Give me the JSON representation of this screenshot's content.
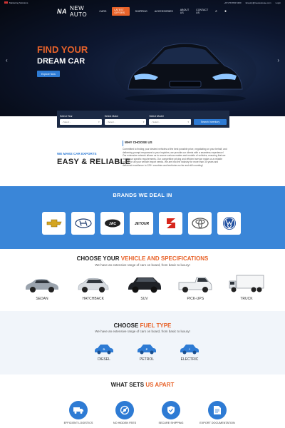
{
  "topbar": {
    "left": "Marketing Solutions",
    "phone": "+971 55 854 6360",
    "email": "Enquiry@newautouae.com",
    "login": "Login"
  },
  "brand": {
    "mark": "NA",
    "name": "NEW AUTO"
  },
  "nav": {
    "items": [
      "CARS",
      "LATEST OFFERS",
      "SHIPPING",
      "ACCESSORIES",
      "ABOUT US",
      "CONTACT US"
    ],
    "active_index": 1
  },
  "hero": {
    "line1": "FIND YOUR",
    "line2": "DREAM CAR",
    "button": "Explore Now",
    "prev": "‹",
    "next": "›"
  },
  "search": {
    "year_label": "Select Year",
    "year_value": "- Select -",
    "make_label": "Select Make",
    "make_value": "- Select -",
    "model_label": "Select Model",
    "model_value": "- Select -",
    "button": "Search Inventory"
  },
  "why": {
    "kicker": "WE MAKE CAR EXPORTS",
    "heading": "EASY & RELIABLE",
    "title": "WHY CHOOSE US",
    "text": "Committed to finding your desired vehicles at the best possible price, negotiating on your behalf, and delivering prompt responses to your inquiries, we provide our clients with a seamless experience! Our extensive network allows us to source various makes and models of vehicles, ensuring that we meet your specific requirements. Our competitive pricing and efficient service make us a reliable choice for all your vehicle import needs. We are into the industry for more than 30 years and delivered excellence to 125+ countries and territories so far and still counting!"
  },
  "brands": {
    "title": "BRANDS WE DEAL IN",
    "logos": [
      "chevrolet",
      "hyundai",
      "jac",
      "jetour",
      "suzuki",
      "toyota",
      "volkswagen"
    ],
    "jac_text": "JAC",
    "jetour_text": "JETOUR"
  },
  "vehicles": {
    "title_a": "CHOOSE YOUR ",
    "title_b": "VEHICLE AND SPECIFICATIONS",
    "subtitle": "We have an extensive range of cars on board, from basic to luxury!",
    "items": [
      "SEDAN",
      "HATCHBACK",
      "SUV",
      "PICK-UPS",
      "TRUCK"
    ]
  },
  "fuel": {
    "title_a": "CHOOSE ",
    "title_b": "FUEL TYPE",
    "subtitle": "We have an extensive range of cars on board, from basic to luxury!",
    "items": [
      "DIESEL",
      "PETROL",
      "ELECTRIC"
    ],
    "badges": [
      "D",
      "P",
      "⚡"
    ]
  },
  "apart": {
    "title_a": "WHAT SETS ",
    "title_b": "US APART",
    "items": [
      "EFFICIENT LOGISTICS",
      "NO HIDDEN FEES",
      "SECURE SHIPPING",
      "EXPORT DOCUMENTATION"
    ]
  },
  "colors": {
    "accent": "#e8632a",
    "primary": "#2e7bd4",
    "brand_band": "#3a86d8",
    "search_bg": "#1c2a45"
  }
}
